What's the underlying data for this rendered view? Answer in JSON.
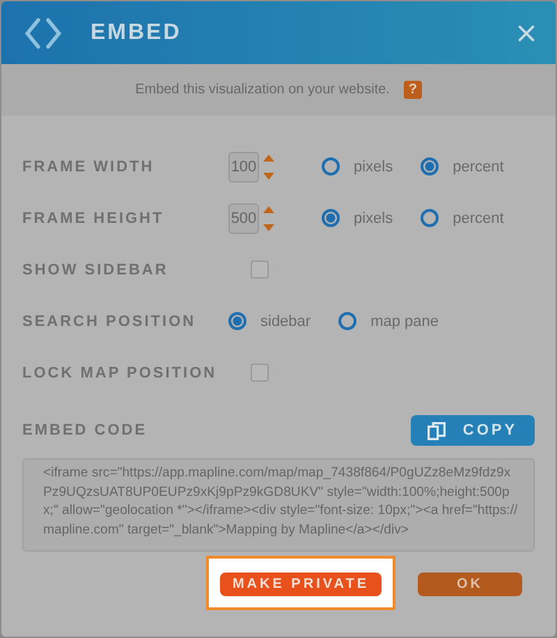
{
  "dialog": {
    "title": "EMBED",
    "subtitle": "Embed this visualization on your website.",
    "help": "?"
  },
  "settings": [
    {
      "kind": "size",
      "label": "FRAME WIDTH",
      "value": "100",
      "options": [
        {
          "label": "pixels",
          "selected": false
        },
        {
          "label": "percent",
          "selected": true
        }
      ]
    },
    {
      "kind": "size",
      "label": "FRAME HEIGHT",
      "value": "500",
      "options": [
        {
          "label": "pixels",
          "selected": true
        },
        {
          "label": "percent",
          "selected": false
        }
      ]
    },
    {
      "kind": "checkbox",
      "label": "SHOW SIDEBAR",
      "checked": false
    },
    {
      "kind": "radio",
      "label": "SEARCH POSITION",
      "options": [
        {
          "label": "sidebar",
          "selected": true
        },
        {
          "label": "map pane",
          "selected": false
        }
      ]
    },
    {
      "kind": "checkbox",
      "label": "LOCK MAP POSITION",
      "checked": false
    }
  ],
  "embed": {
    "label": "EMBED CODE",
    "copy": "COPY",
    "code": "<iframe src=\"https://app.mapline.com/map/map_7438f864/P0gUZz8eMz9fdz9xPz9UQzsUAT8UP0EUPz9xKj9pPz9kGD8UKV\" style=\"width:100%;height:500px;\" allow=\"geolocation *\"></iframe><div style=\"font-size: 10px;\"><a href=\"https://mapline.com\" target=\"_blank\">Mapping by Mapline</a></div>"
  },
  "buttons": [
    {
      "kind": "primary",
      "label": "MAKE PRIVATE",
      "highlighted": true
    },
    {
      "kind": "secondary",
      "label": "OK",
      "highlighted": false
    }
  ]
}
